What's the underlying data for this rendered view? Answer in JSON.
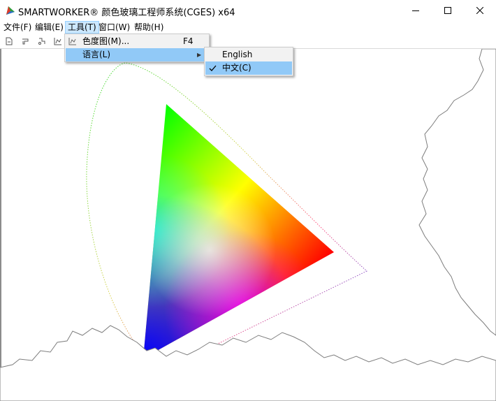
{
  "window": {
    "title": "SMARTWORKER® 颜色玻璃工程师系统(CGES) x64",
    "icon": "app-logo-icon"
  },
  "menubar": {
    "items": [
      {
        "label": "文件(F)"
      },
      {
        "label": "编辑(E)"
      },
      {
        "label": "工具(T)"
      },
      {
        "label": "窗口(W)"
      },
      {
        "label": "帮助(H)"
      }
    ]
  },
  "tools_menu": {
    "items": [
      {
        "label": "色度图(M)...",
        "shortcut": "F4",
        "icon": "chart-icon"
      },
      {
        "label": "语言(L)",
        "submenu": true
      }
    ]
  },
  "language_menu": {
    "items": [
      {
        "label": "English",
        "checked": false
      },
      {
        "label": "中文(C)",
        "checked": true
      }
    ]
  },
  "toolbar": {
    "icons": [
      "new-document-icon",
      "open-icon",
      "save-icon",
      "chart-icon"
    ]
  },
  "colors": {
    "menu_highlight": "#91c9f7",
    "menubar_active": "#cce8ff"
  }
}
